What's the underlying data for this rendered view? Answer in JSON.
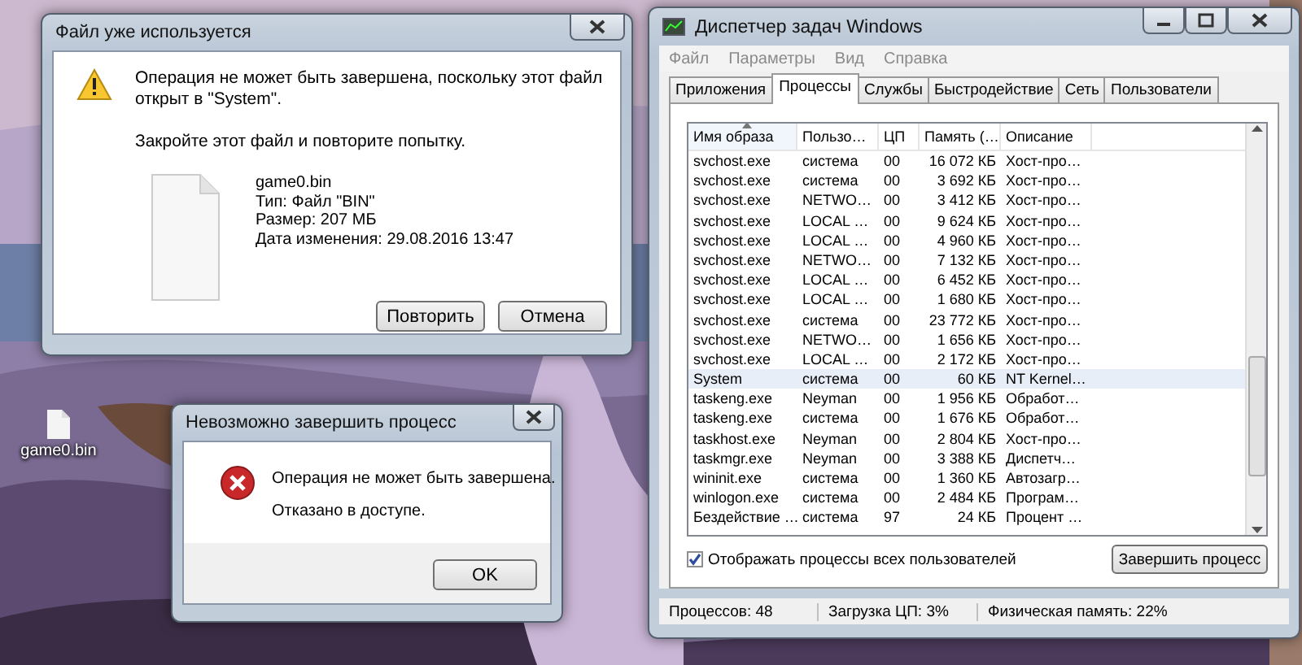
{
  "desktop": {
    "icons": [
      {
        "label": "game0.bin"
      }
    ]
  },
  "file_in_use_dialog": {
    "title": "Файл уже используется",
    "message": "Операция не может быть завершена, поскольку этот файл открыт в \"System\".",
    "hint": "Закройте этот файл и повторите попытку.",
    "file": {
      "name": "game0.bin",
      "type": "Тип: Файл \"BIN\"",
      "size": "Размер: 207 МБ",
      "modified": "Дата изменения: 29.08.2016 13:47"
    },
    "buttons": [
      "Повторить",
      "Отмена"
    ]
  },
  "error_dialog": {
    "title": "Невозможно завершить процесс",
    "messages": [
      "Операция не может быть завершена.",
      "Отказано в доступе."
    ],
    "buttons": [
      "OK"
    ]
  },
  "task_manager": {
    "title": "Диспетчер задач Windows",
    "menu": [
      "Файл",
      "Параметры",
      "Вид",
      "Справка"
    ],
    "tabs": [
      {
        "label": "Приложения",
        "selected": false
      },
      {
        "label": "Процессы",
        "selected": true
      },
      {
        "label": "Службы",
        "selected": false
      },
      {
        "label": "Быстродействие",
        "selected": false
      },
      {
        "label": "Сеть",
        "selected": false
      },
      {
        "label": "Пользователи",
        "selected": false
      }
    ],
    "table": {
      "columns": [
        "Имя образа",
        "Пользо…",
        "ЦП",
        "Память (…",
        "Описание"
      ],
      "rows": [
        {
          "cells": [
            "svchost.exe",
            "система",
            "00",
            "16 072 КБ",
            "Хост-про…"
          ],
          "selected": false
        },
        {
          "cells": [
            "svchost.exe",
            "система",
            "00",
            "3 692 КБ",
            "Хост-про…"
          ],
          "selected": false
        },
        {
          "cells": [
            "svchost.exe",
            "NETWO…",
            "00",
            "3 412 КБ",
            "Хост-про…"
          ],
          "selected": false
        },
        {
          "cells": [
            "svchost.exe",
            "LOCAL …",
            "00",
            "9 624 КБ",
            "Хост-про…"
          ],
          "selected": false
        },
        {
          "cells": [
            "svchost.exe",
            "LOCAL …",
            "00",
            "4 960 КБ",
            "Хост-про…"
          ],
          "selected": false
        },
        {
          "cells": [
            "svchost.exe",
            "NETWO…",
            "00",
            "7 132 КБ",
            "Хост-про…"
          ],
          "selected": false
        },
        {
          "cells": [
            "svchost.exe",
            "LOCAL …",
            "00",
            "6 452 КБ",
            "Хост-про…"
          ],
          "selected": false
        },
        {
          "cells": [
            "svchost.exe",
            "LOCAL …",
            "00",
            "1 680 КБ",
            "Хост-про…"
          ],
          "selected": false
        },
        {
          "cells": [
            "svchost.exe",
            "система",
            "00",
            "23 772 КБ",
            "Хост-про…"
          ],
          "selected": false
        },
        {
          "cells": [
            "svchost.exe",
            "NETWO…",
            "00",
            "1 656 КБ",
            "Хост-про…"
          ],
          "selected": false
        },
        {
          "cells": [
            "svchost.exe",
            "LOCAL …",
            "00",
            "2 172 КБ",
            "Хост-про…"
          ],
          "selected": false
        },
        {
          "cells": [
            "System",
            "система",
            "00",
            "60 КБ",
            "NT Kernel…"
          ],
          "selected": true
        },
        {
          "cells": [
            "taskeng.exe",
            "Neyman",
            "00",
            "1 956 КБ",
            "Обработ…"
          ],
          "selected": false
        },
        {
          "cells": [
            "taskeng.exe",
            "система",
            "00",
            "1 676 КБ",
            "Обработ…"
          ],
          "selected": false
        },
        {
          "cells": [
            "taskhost.exe",
            "Neyman",
            "00",
            "2 804 КБ",
            "Хост-про…"
          ],
          "selected": false
        },
        {
          "cells": [
            "taskmgr.exe",
            "Neyman",
            "00",
            "3 388 КБ",
            "Диспетч…"
          ],
          "selected": false
        },
        {
          "cells": [
            "wininit.exe",
            "система",
            "00",
            "1 360 КБ",
            "Автозагр…"
          ],
          "selected": false
        },
        {
          "cells": [
            "winlogon.exe",
            "система",
            "00",
            "2 484 КБ",
            "Програм…"
          ],
          "selected": false
        },
        {
          "cells": [
            "Бездействие …",
            "система",
            "97",
            "24 КБ",
            "Процент …"
          ],
          "selected": false
        }
      ]
    },
    "show_all_users": {
      "label": "Отображать процессы всех пользователей",
      "checked": true
    },
    "end_button": "Завершить процесс",
    "status_bar": [
      "Процессов: 48",
      "Загрузка ЦП: 3%",
      "Физическая память: 22%"
    ]
  }
}
